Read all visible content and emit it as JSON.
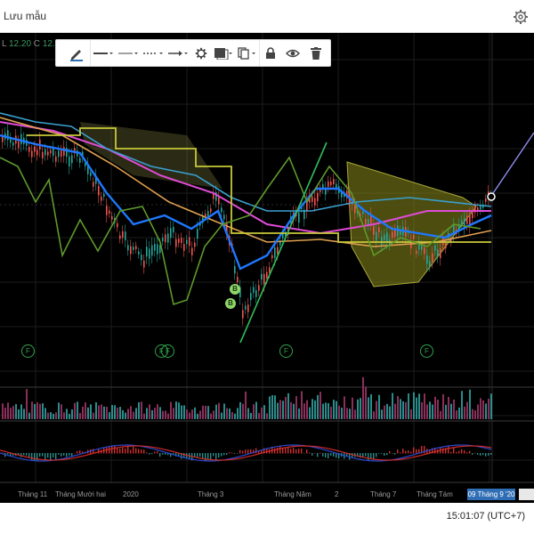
{
  "header": {
    "save_label": "Lưu mẫu",
    "settings_icon": "gear-icon"
  },
  "legend": {
    "low_label": "L",
    "low_value": "12.20",
    "close_label": "C",
    "close_value": "12."
  },
  "drawing_toolbar": {
    "tools": [
      "pencil-icon",
      "line-style-icon",
      "line-width-icon",
      "dotted-line-icon",
      "arrow-line-icon",
      "gear-icon",
      "fill-color-icon",
      "clone-icon",
      "lock-icon",
      "eye-icon",
      "trash-icon"
    ]
  },
  "time_axis": {
    "labels": [
      "Tháng 11",
      "Tháng Mười hai",
      "2020",
      "Tháng 3",
      "Tháng Năm",
      "2",
      "Tháng 7",
      "Tháng Tám"
    ],
    "current_date": "09 Tháng 9 '20"
  },
  "markers": {
    "f": [
      "F",
      "F",
      "F",
      "F",
      "F"
    ],
    "b": [
      "B",
      "B"
    ]
  },
  "footer": {
    "clock": "15:01:07 (UTC+7)"
  },
  "colors": {
    "chart_bg": "#000000",
    "up": "#26a69a",
    "down": "#ef5350",
    "accent": "#2f6db5"
  }
}
